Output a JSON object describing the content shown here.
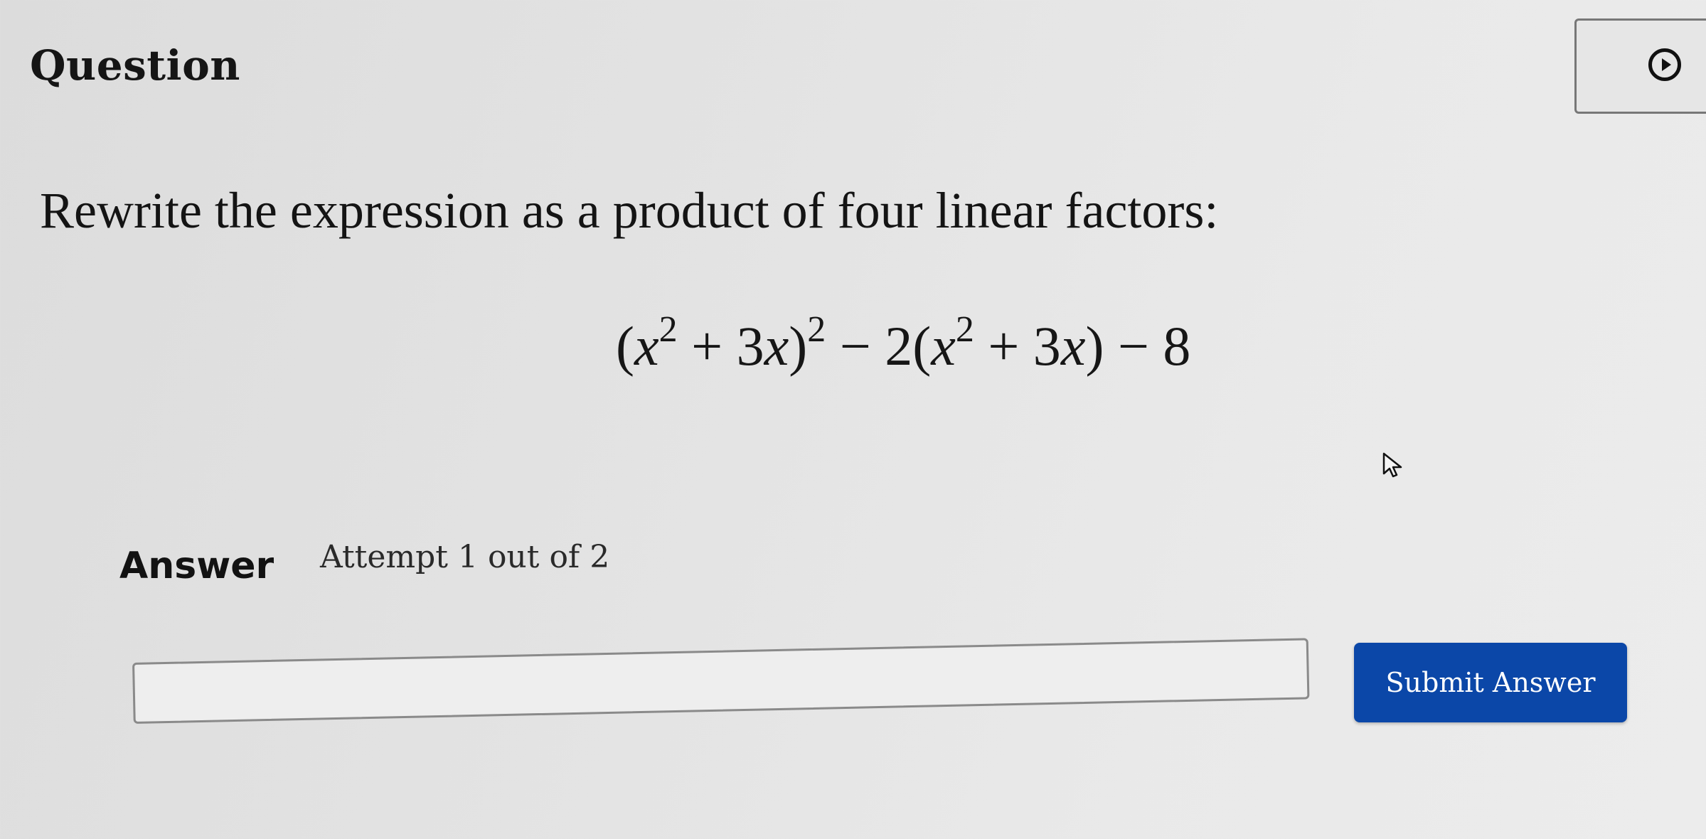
{
  "header": {
    "title": "Question",
    "video_icon": "play-circle-icon"
  },
  "question": {
    "prompt": "Rewrite the expression as a product of four linear factors:",
    "expression": {
      "open_paren_1": "(",
      "var_1": "x",
      "exp_1": "2",
      "plus_3x_1": " + 3",
      "var_2": "x",
      "close_paren_1": ")",
      "exp_2": "2",
      "minus_2": " − 2(",
      "var_3": "x",
      "exp_3": "2",
      "plus_3x_2": " + 3",
      "var_4": "x",
      "tail": ") − 8"
    }
  },
  "answer": {
    "label": "Answer",
    "attempt": "Attempt 1 out of 2",
    "input_value": "",
    "submit_label": "Submit Answer"
  },
  "colors": {
    "submit_button": "#0b47a8",
    "background": "#e4e4e4"
  },
  "cursor": "arrow-cursor-icon"
}
